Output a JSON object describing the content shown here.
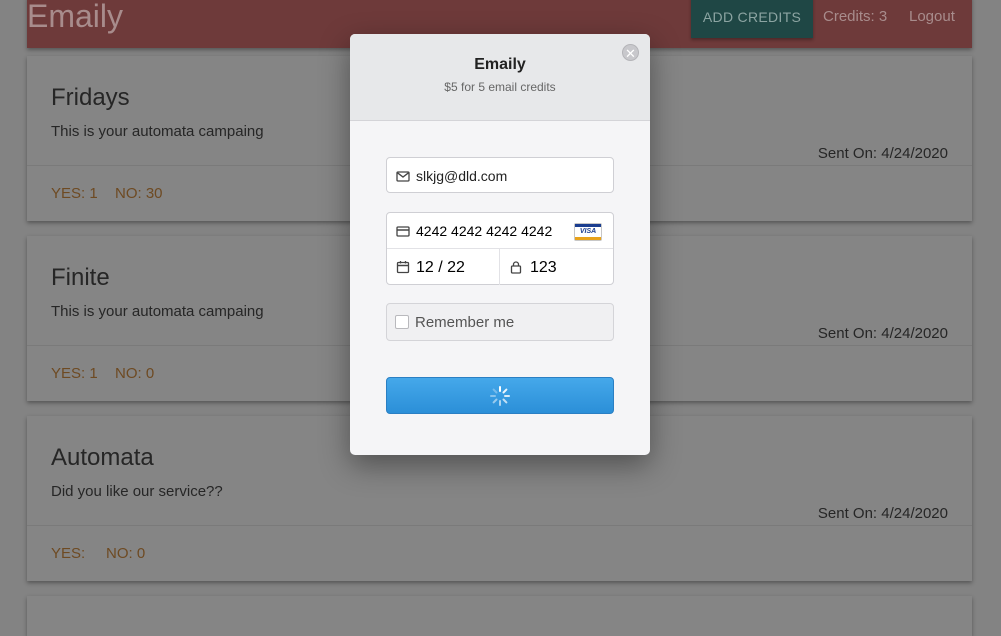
{
  "header": {
    "brand": "Emaily",
    "add_credits_label": "Add Credits",
    "credits_label": "Credits: 3",
    "logout_label": "Logout"
  },
  "surveys": [
    {
      "title": "Fridays",
      "body": "This is your automata campaing",
      "sent": "Sent On: 4/24/2020",
      "yes": "YES: 1",
      "no": "NO: 30"
    },
    {
      "title": "Finite",
      "body": "This is your automata campaing",
      "sent": "Sent On: 4/24/2020",
      "yes": "YES: 1",
      "no": "NO: 0"
    },
    {
      "title": "Automata",
      "body": "Did you like our service??",
      "sent": "Sent On: 4/24/2020",
      "yes": "YES:",
      "no": "NO: 0"
    }
  ],
  "checkout": {
    "title": "Emaily",
    "subtitle": "$5 for 5 email credits",
    "close_glyph": "✕",
    "email_value": "slkjg@dld.com",
    "card_number": "4242 4242 4242 4242",
    "card_brand": "VISA",
    "expiry": "12 / 22",
    "cvc": "123",
    "remember_label": "Remember me",
    "pay_state": "loading"
  },
  "colors": {
    "overlay": "#838383",
    "nav": "#6e3a3a",
    "add_credits": "#1f4745",
    "pay_button": "#3a9de2"
  },
  "icons": [
    "mail-icon",
    "credit-card-icon",
    "calendar-icon",
    "lock-icon",
    "close-icon",
    "spinner-icon"
  ]
}
